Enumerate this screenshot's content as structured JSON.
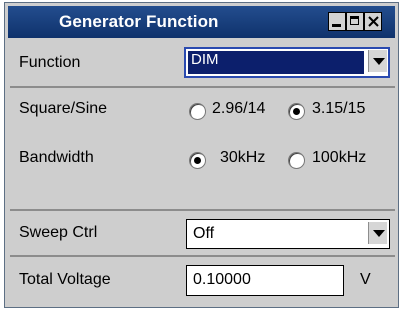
{
  "window": {
    "title": "Generator Function"
  },
  "function": {
    "label": "Function",
    "value": "DIM"
  },
  "square_sine": {
    "label": "Square/Sine",
    "options": [
      "2.96/14",
      "3.15/15"
    ],
    "selected": "3.15/15"
  },
  "bandwidth": {
    "label": "Bandwidth",
    "options": [
      "30kHz",
      "100kHz"
    ],
    "selected": "30kHz"
  },
  "sweep_ctrl": {
    "label": "Sweep Ctrl",
    "value": "Off"
  },
  "total_voltage": {
    "label": "Total Voltage",
    "value": "0.10000",
    "unit": "V"
  }
}
